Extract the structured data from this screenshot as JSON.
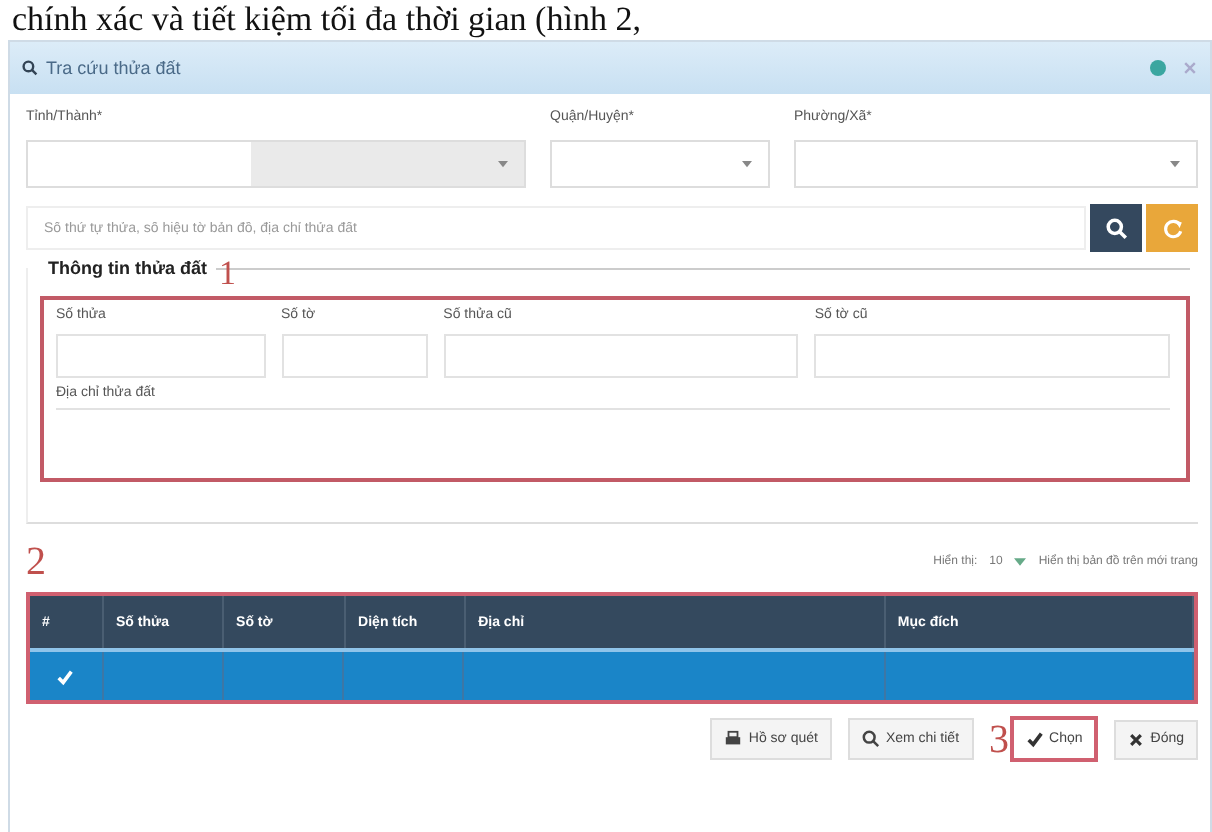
{
  "caption": "chính xác và tiết kiệm tối đa thời gian (hình 2,",
  "window": {
    "title": "Tra cứu thửa đất"
  },
  "filters": [
    {
      "label": "Tỉnh/Thành*",
      "disabled": true
    },
    {
      "label": "Quận/Huyện*",
      "disabled": false
    },
    {
      "label": "Phường/Xã*",
      "disabled": false
    }
  ],
  "search": {
    "placeholder": "Số thứ tự thửa, số hiệu tờ bản đồ, địa chỉ thửa đất"
  },
  "section": {
    "title": "Thông tin thửa đất",
    "marker": "1",
    "fields": [
      {
        "label": "Số thửa"
      },
      {
        "label": "Số tờ"
      },
      {
        "label": "Số thửa cũ"
      },
      {
        "label": "Số tờ cũ"
      }
    ],
    "address_label": "Địa chỉ thửa đất"
  },
  "table_marker": "2",
  "paging": {
    "label": "Hiển thị:",
    "value": "10",
    "toggle": "Hiển thị bản đồ trên mới trang"
  },
  "table": {
    "columns": [
      "#",
      "Số thửa",
      "Số tờ",
      "Diện tích",
      "Địa chỉ",
      "Mục đích"
    ],
    "rows": [
      {
        "selected": true,
        "checked": true
      }
    ]
  },
  "buttons_marker": "3",
  "buttons": [
    {
      "label": "Hồ sơ quét",
      "kind": "print",
      "highlighted": false
    },
    {
      "label": "Xem chi tiết",
      "kind": "view",
      "highlighted": false
    },
    {
      "label": "Chọn",
      "kind": "choose",
      "highlighted": true
    },
    {
      "label": "Đóng",
      "kind": "close",
      "highlighted": false
    }
  ]
}
